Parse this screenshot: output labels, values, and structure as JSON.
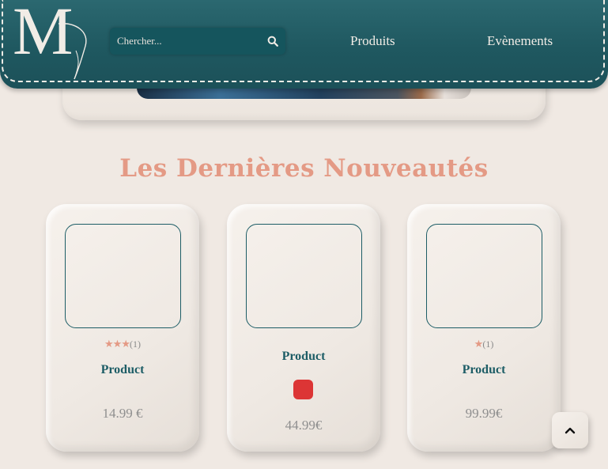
{
  "header": {
    "logo_letter": "M",
    "search": {
      "placeholder": "Chercher..."
    },
    "nav": {
      "products": "Produits",
      "events": "Evènements"
    }
  },
  "section": {
    "title": "Les Dernières Nouveautés"
  },
  "products": [
    {
      "name": "Product",
      "price": "14.99 €",
      "rating_stars": 3,
      "rating_count": "(1)"
    },
    {
      "name": "Product",
      "price": "44.99€",
      "swatch_color": "#dc3535"
    },
    {
      "name": "Product",
      "price": "99.99€",
      "rating_stars": 1,
      "rating_count": "(1)"
    }
  ],
  "colors": {
    "primary": "#1d5d66",
    "accent": "#e49a85",
    "background": "#f0e9e3"
  },
  "icons": {
    "search": "search-icon",
    "scroll_top": "chevron-up-icon"
  }
}
